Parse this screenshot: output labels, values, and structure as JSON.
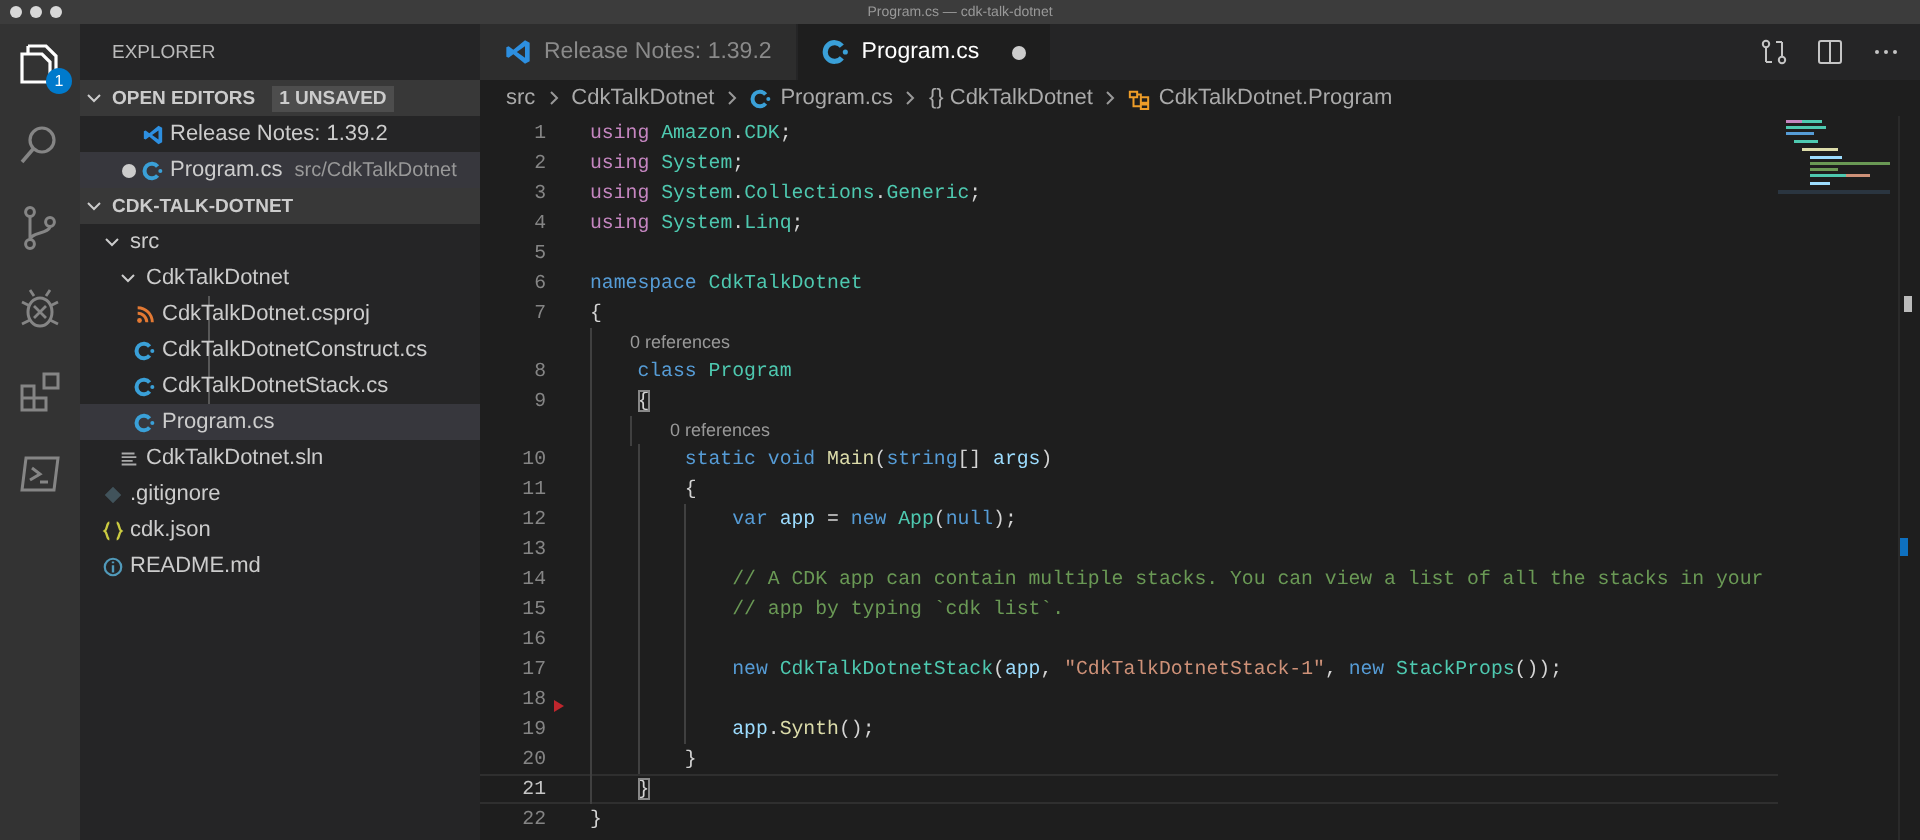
{
  "window": {
    "title": "Program.cs — cdk-talk-dotnet"
  },
  "activity_bar": [
    {
      "kind": "files",
      "selected": true,
      "badge": "1"
    },
    {
      "kind": "search",
      "selected": false
    },
    {
      "kind": "scm",
      "selected": false
    },
    {
      "kind": "debug",
      "selected": false
    },
    {
      "kind": "extensions",
      "selected": false
    },
    {
      "kind": "terminal",
      "selected": false
    }
  ],
  "sidebar": {
    "title": "EXPLORER",
    "open_editors": {
      "title": "OPEN EDITORS",
      "badge": "1 UNSAVED",
      "expanded": true,
      "items": [
        {
          "kind": "vscode",
          "label": "Release Notes: 1.39.2",
          "dirty": false,
          "selected": false
        },
        {
          "kind": "cs",
          "label": "Program.cs",
          "path": "src/CdkTalkDotnet",
          "dirty": true,
          "selected": true
        }
      ]
    },
    "folder": {
      "title": "CDK-TALK-DOTNET",
      "expanded": true,
      "items": [
        {
          "kind": "folder",
          "label": "src",
          "expanded": true,
          "selected": false,
          "children": [
            {
              "kind": "folder",
              "label": "CdkTalkDotnet",
              "expanded": true,
              "selected": false,
              "children": [
                {
                  "kind": "csproj",
                  "label": "CdkTalkDotnet.csproj",
                  "selected": false
                },
                {
                  "kind": "cs",
                  "label": "CdkTalkDotnetConstruct.cs",
                  "selected": false
                },
                {
                  "kind": "cs",
                  "label": "CdkTalkDotnetStack.cs",
                  "selected": false
                },
                {
                  "kind": "cs",
                  "label": "Program.cs",
                  "selected": true
                }
              ]
            },
            {
              "kind": "sln",
              "label": "CdkTalkDotnet.sln",
              "selected": false
            }
          ]
        },
        {
          "kind": "git",
          "label": ".gitignore",
          "selected": false
        },
        {
          "kind": "json",
          "label": "cdk.json",
          "selected": false
        },
        {
          "kind": "info",
          "label": "README.md",
          "selected": false
        }
      ]
    }
  },
  "tabs": [
    {
      "kind": "vscode",
      "label": "Release Notes: 1.39.2",
      "selected": false,
      "dirty": false
    },
    {
      "kind": "cs",
      "label": "Program.cs",
      "selected": true,
      "dirty": true
    }
  ],
  "tab_actions": [
    {
      "kind": "compare"
    },
    {
      "kind": "split"
    },
    {
      "kind": "more"
    }
  ],
  "breadcrumbs": [
    {
      "kind": "none",
      "label": "src"
    },
    {
      "kind": "none",
      "label": "CdkTalkDotnet"
    },
    {
      "kind": "cs",
      "label": "Program.cs"
    },
    {
      "kind": "namespace",
      "label": "{} CdkTalkDotnet"
    },
    {
      "kind": "class",
      "label": "CdkTalkDotnet.Program"
    }
  ],
  "code": [
    {
      "number": "1",
      "tokens": [
        {
          "kind": "control",
          "text": "using "
        },
        {
          "kind": "type",
          "text": "Amazon"
        },
        {
          "kind": "plain",
          "text": "."
        },
        {
          "kind": "type",
          "text": "CDK"
        },
        {
          "kind": "plain",
          "text": ";"
        }
      ]
    },
    {
      "number": "2",
      "tokens": [
        {
          "kind": "control",
          "text": "using "
        },
        {
          "kind": "type",
          "text": "System"
        },
        {
          "kind": "plain",
          "text": ";"
        }
      ]
    },
    {
      "number": "3",
      "tokens": [
        {
          "kind": "control",
          "text": "using "
        },
        {
          "kind": "type",
          "text": "System"
        },
        {
          "kind": "plain",
          "text": "."
        },
        {
          "kind": "type",
          "text": "Collections"
        },
        {
          "kind": "plain",
          "text": "."
        },
        {
          "kind": "type",
          "text": "Generic"
        },
        {
          "kind": "plain",
          "text": ";"
        }
      ]
    },
    {
      "number": "4",
      "tokens": [
        {
          "kind": "control",
          "text": "using "
        },
        {
          "kind": "type",
          "text": "System"
        },
        {
          "kind": "plain",
          "text": "."
        },
        {
          "kind": "type",
          "text": "Linq"
        },
        {
          "kind": "plain",
          "text": ";"
        }
      ]
    },
    {
      "number": "5"
    },
    {
      "number": "6",
      "tokens": [
        {
          "kind": "keyword",
          "text": "namespace "
        },
        {
          "kind": "type",
          "text": "CdkTalkDotnet"
        }
      ]
    },
    {
      "number": "7",
      "tokens": [
        {
          "kind": "plain",
          "text": "{"
        }
      ]
    },
    {
      "number": "8",
      "lens": "0 references",
      "tokens": [
        {
          "kind": "keyword",
          "text": "    class "
        },
        {
          "kind": "type",
          "text": "Program"
        }
      ]
    },
    {
      "number": "9",
      "tokens": [
        {
          "kind": "bracket",
          "text": "    {"
        }
      ]
    },
    {
      "number": "10",
      "lens": "0 references",
      "tokens": [
        {
          "kind": "keyword",
          "text": "        static void "
        },
        {
          "kind": "function",
          "text": "Main"
        },
        {
          "kind": "plain",
          "text": "("
        },
        {
          "kind": "keyword",
          "text": "string"
        },
        {
          "kind": "plain",
          "text": "[] "
        },
        {
          "kind": "variable",
          "text": "args"
        },
        {
          "kind": "plain",
          "text": ")"
        }
      ]
    },
    {
      "number": "11",
      "tokens": [
        {
          "kind": "plain",
          "text": "        {"
        }
      ]
    },
    {
      "number": "12",
      "tokens": [
        {
          "kind": "keyword",
          "text": "            var "
        },
        {
          "kind": "variable",
          "text": "app"
        },
        {
          "kind": "plain",
          "text": " = "
        },
        {
          "kind": "keyword",
          "text": "new "
        },
        {
          "kind": "type",
          "text": "App"
        },
        {
          "kind": "plain",
          "text": "("
        },
        {
          "kind": "keyword",
          "text": "null"
        },
        {
          "kind": "plain",
          "text": ");"
        }
      ]
    },
    {
      "number": "13"
    },
    {
      "number": "14",
      "tokens": [
        {
          "kind": "comment",
          "text": "            // A CDK app can contain multiple stacks. You can view a list of all the stacks in your"
        }
      ]
    },
    {
      "number": "15",
      "tokens": [
        {
          "kind": "comment",
          "text": "            // app by typing `cdk list`."
        }
      ]
    },
    {
      "number": "16"
    },
    {
      "number": "17",
      "tokens": [
        {
          "kind": "keyword",
          "text": "            new "
        },
        {
          "kind": "type",
          "text": "CdkTalkDotnetStack"
        },
        {
          "kind": "plain",
          "text": "("
        },
        {
          "kind": "variable",
          "text": "app"
        },
        {
          "kind": "plain",
          "text": ", "
        },
        {
          "kind": "string",
          "text": "\"CdkTalkDotnetStack-1\""
        },
        {
          "kind": "plain",
          "text": ", "
        },
        {
          "kind": "keyword",
          "text": "new "
        },
        {
          "kind": "type",
          "text": "StackProps"
        },
        {
          "kind": "plain",
          "text": "());"
        }
      ]
    },
    {
      "number": "18",
      "changed": true
    },
    {
      "number": "19",
      "tokens": [
        {
          "kind": "variable",
          "text": "            app"
        },
        {
          "kind": "plain",
          "text": "."
        },
        {
          "kind": "function",
          "text": "Synth"
        },
        {
          "kind": "plain",
          "text": "();"
        }
      ]
    },
    {
      "number": "20",
      "tokens": [
        {
          "kind": "plain",
          "text": "        }"
        }
      ]
    },
    {
      "number": "21",
      "current": true,
      "tokens": [
        {
          "kind": "bracket",
          "text": "    }"
        }
      ]
    },
    {
      "number": "22",
      "tokens": [
        {
          "kind": "plain",
          "text": "}"
        }
      ]
    }
  ]
}
